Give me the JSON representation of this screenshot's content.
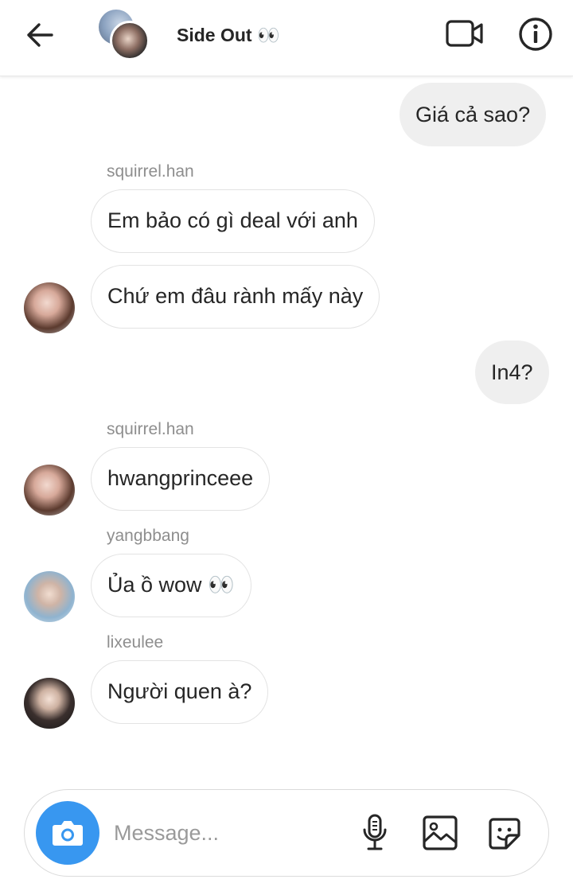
{
  "header": {
    "title": "Side Out",
    "title_emoji": "👀",
    "back_icon": "arrow-left-icon",
    "video_icon": "video-camera-icon",
    "info_icon": "info-icon"
  },
  "messages": [
    {
      "direction": "outgoing",
      "text": "Giá cả sao?"
    },
    {
      "direction": "incoming",
      "sender": "squirrel.han",
      "text": "Em bảo có gì deal với anh"
    },
    {
      "direction": "incoming",
      "text": "Chứ em đâu rành mấy này"
    },
    {
      "direction": "outgoing",
      "text": "In4?"
    },
    {
      "direction": "incoming",
      "sender": "squirrel.han",
      "text": "hwangprinceee"
    },
    {
      "direction": "incoming",
      "sender": "yangbbang",
      "text": "Ủa ồ wow 👀"
    },
    {
      "direction": "incoming",
      "sender": "lixeulee",
      "text": "Người quen à?"
    }
  ],
  "composer": {
    "placeholder": "Message...",
    "camera_icon": "camera-icon",
    "mic_icon": "microphone-icon",
    "gallery_icon": "image-gallery-icon",
    "sticker_icon": "sticker-icon"
  },
  "colors": {
    "accent": "#3897f0",
    "outgoing_bubble": "#efefef",
    "incoming_border": "#e3e3e3",
    "sender_text": "#8e8e8e"
  }
}
